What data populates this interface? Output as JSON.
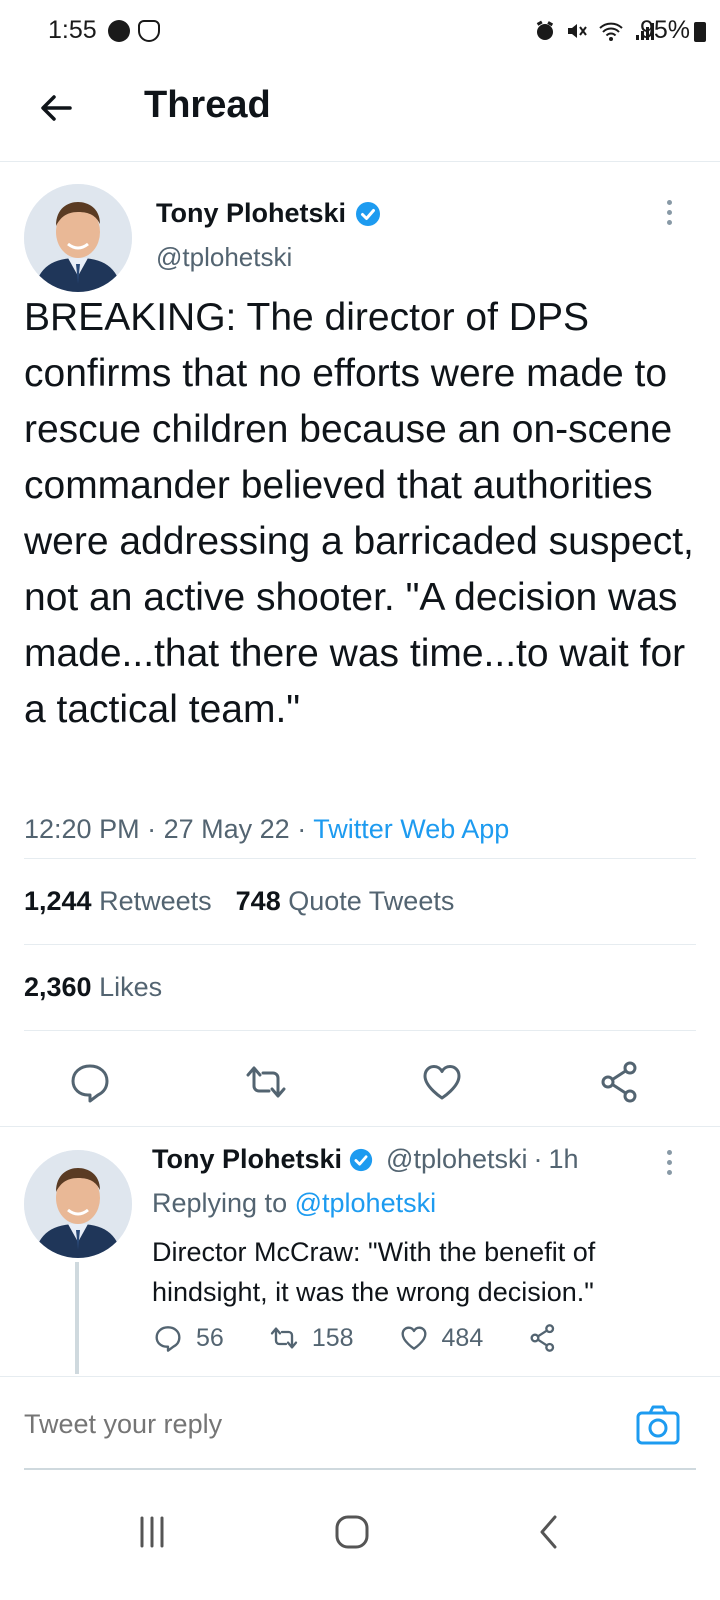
{
  "status_bar": {
    "time": "1:55",
    "battery": "95%",
    "left_icons": [
      "messenger-icon",
      "shield-icon"
    ],
    "right_icons": [
      "alarm-icon",
      "mute-icon",
      "wifi-icon",
      "signal-icon"
    ]
  },
  "header": {
    "title": "Thread",
    "back_icon": "arrow-left-icon"
  },
  "main_tweet": {
    "author_name": "Tony Plohetski",
    "handle": "@tplohetski",
    "verified": true,
    "text": "BREAKING: The director of DPS confirms that no efforts were made to rescue children because an on-scene commander believed that authorities were addressing a barricaded suspect, not an active shooter. \"A decision was made...that there was time...to wait for a tactical team.\"",
    "time": "12:20 PM",
    "date": "27 May 22",
    "separator": "·",
    "source": "Twitter Web App",
    "stats": {
      "retweets_count": "1,244",
      "retweets_label": "Retweets",
      "quotes_count": "748",
      "quotes_label": "Quote Tweets",
      "likes_count": "2,360",
      "likes_label": "Likes"
    },
    "actions": [
      "reply-icon",
      "retweet-icon",
      "like-icon",
      "share-icon"
    ]
  },
  "reply_tweet": {
    "author_name": "Tony Plohetski",
    "handle": "@tplohetski",
    "dot": "·",
    "age": "1h",
    "replying_prefix": "Replying to",
    "replying_handle": "@tplohetski",
    "text": "Director McCraw: \"With the benefit of hindsight, it was the wrong decision.\"",
    "reply_count": "56",
    "retweet_count": "158",
    "like_count": "484"
  },
  "composer": {
    "placeholder": "Tweet your reply"
  },
  "colors": {
    "accent": "#1d9bf0",
    "text": "#0f1419",
    "secondary": "#536471",
    "divider": "#e6ecf0"
  }
}
